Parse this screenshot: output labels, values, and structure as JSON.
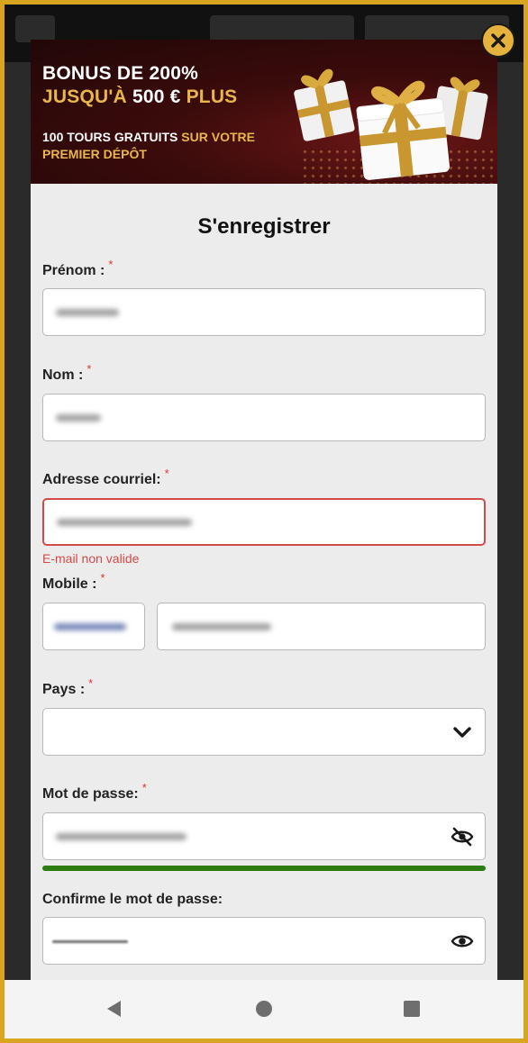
{
  "banner": {
    "line1": "BONUS DE 200%",
    "line2_gold": "JUSQU'À",
    "line2_white": "500 €",
    "line2_gold2": "PLUS",
    "line3_white": "100 TOURS GRATUITS",
    "line3_gold": "SUR VOTRE",
    "line4_gold": "PREMIER DÉPÔT"
  },
  "modal": {
    "close_icon": "close-icon",
    "title": "S'enregistrer"
  },
  "form": {
    "first_name": {
      "label": "Prénom :",
      "required": "*"
    },
    "last_name": {
      "label": "Nom :",
      "required": "*"
    },
    "email": {
      "label": "Adresse courriel:",
      "required": "*",
      "error": "E-mail non valide"
    },
    "mobile": {
      "label": "Mobile :",
      "required": "*"
    },
    "country": {
      "label": "Pays :",
      "required": "*",
      "icon": "chevron-down-icon"
    },
    "password": {
      "label": "Mot de passe:",
      "required": "*",
      "icon": "eye-off-icon",
      "strength": 1.0
    },
    "confirm_password": {
      "label": "Confirme le mot de passe:",
      "icon": "eye-icon"
    }
  },
  "colors": {
    "accent_gold": "#e8b64b",
    "error_red": "#d34a4a",
    "strength_green": "#2e7d12",
    "frame_gold": "#d9a521"
  },
  "navbar": {
    "back_icon": "back-triangle-icon",
    "home_icon": "home-circle-icon",
    "recents_icon": "recents-square-icon"
  }
}
